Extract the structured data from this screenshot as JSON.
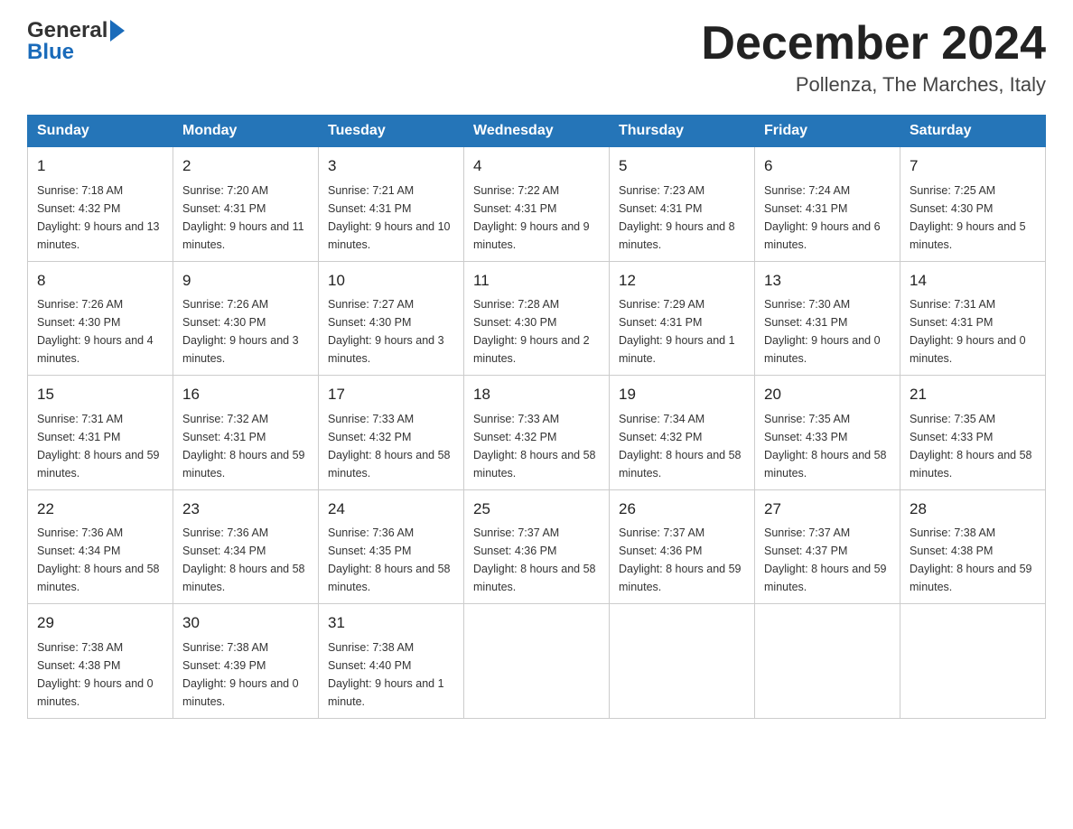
{
  "header": {
    "logo_general": "General",
    "logo_blue": "Blue",
    "month_title": "December 2024",
    "location": "Pollenza, The Marches, Italy"
  },
  "days_of_week": [
    "Sunday",
    "Monday",
    "Tuesday",
    "Wednesday",
    "Thursday",
    "Friday",
    "Saturday"
  ],
  "weeks": [
    [
      {
        "day": "1",
        "sunrise": "Sunrise: 7:18 AM",
        "sunset": "Sunset: 4:32 PM",
        "daylight": "Daylight: 9 hours and 13 minutes."
      },
      {
        "day": "2",
        "sunrise": "Sunrise: 7:20 AM",
        "sunset": "Sunset: 4:31 PM",
        "daylight": "Daylight: 9 hours and 11 minutes."
      },
      {
        "day": "3",
        "sunrise": "Sunrise: 7:21 AM",
        "sunset": "Sunset: 4:31 PM",
        "daylight": "Daylight: 9 hours and 10 minutes."
      },
      {
        "day": "4",
        "sunrise": "Sunrise: 7:22 AM",
        "sunset": "Sunset: 4:31 PM",
        "daylight": "Daylight: 9 hours and 9 minutes."
      },
      {
        "day": "5",
        "sunrise": "Sunrise: 7:23 AM",
        "sunset": "Sunset: 4:31 PM",
        "daylight": "Daylight: 9 hours and 8 minutes."
      },
      {
        "day": "6",
        "sunrise": "Sunrise: 7:24 AM",
        "sunset": "Sunset: 4:31 PM",
        "daylight": "Daylight: 9 hours and 6 minutes."
      },
      {
        "day": "7",
        "sunrise": "Sunrise: 7:25 AM",
        "sunset": "Sunset: 4:30 PM",
        "daylight": "Daylight: 9 hours and 5 minutes."
      }
    ],
    [
      {
        "day": "8",
        "sunrise": "Sunrise: 7:26 AM",
        "sunset": "Sunset: 4:30 PM",
        "daylight": "Daylight: 9 hours and 4 minutes."
      },
      {
        "day": "9",
        "sunrise": "Sunrise: 7:26 AM",
        "sunset": "Sunset: 4:30 PM",
        "daylight": "Daylight: 9 hours and 3 minutes."
      },
      {
        "day": "10",
        "sunrise": "Sunrise: 7:27 AM",
        "sunset": "Sunset: 4:30 PM",
        "daylight": "Daylight: 9 hours and 3 minutes."
      },
      {
        "day": "11",
        "sunrise": "Sunrise: 7:28 AM",
        "sunset": "Sunset: 4:30 PM",
        "daylight": "Daylight: 9 hours and 2 minutes."
      },
      {
        "day": "12",
        "sunrise": "Sunrise: 7:29 AM",
        "sunset": "Sunset: 4:31 PM",
        "daylight": "Daylight: 9 hours and 1 minute."
      },
      {
        "day": "13",
        "sunrise": "Sunrise: 7:30 AM",
        "sunset": "Sunset: 4:31 PM",
        "daylight": "Daylight: 9 hours and 0 minutes."
      },
      {
        "day": "14",
        "sunrise": "Sunrise: 7:31 AM",
        "sunset": "Sunset: 4:31 PM",
        "daylight": "Daylight: 9 hours and 0 minutes."
      }
    ],
    [
      {
        "day": "15",
        "sunrise": "Sunrise: 7:31 AM",
        "sunset": "Sunset: 4:31 PM",
        "daylight": "Daylight: 8 hours and 59 minutes."
      },
      {
        "day": "16",
        "sunrise": "Sunrise: 7:32 AM",
        "sunset": "Sunset: 4:31 PM",
        "daylight": "Daylight: 8 hours and 59 minutes."
      },
      {
        "day": "17",
        "sunrise": "Sunrise: 7:33 AM",
        "sunset": "Sunset: 4:32 PM",
        "daylight": "Daylight: 8 hours and 58 minutes."
      },
      {
        "day": "18",
        "sunrise": "Sunrise: 7:33 AM",
        "sunset": "Sunset: 4:32 PM",
        "daylight": "Daylight: 8 hours and 58 minutes."
      },
      {
        "day": "19",
        "sunrise": "Sunrise: 7:34 AM",
        "sunset": "Sunset: 4:32 PM",
        "daylight": "Daylight: 8 hours and 58 minutes."
      },
      {
        "day": "20",
        "sunrise": "Sunrise: 7:35 AM",
        "sunset": "Sunset: 4:33 PM",
        "daylight": "Daylight: 8 hours and 58 minutes."
      },
      {
        "day": "21",
        "sunrise": "Sunrise: 7:35 AM",
        "sunset": "Sunset: 4:33 PM",
        "daylight": "Daylight: 8 hours and 58 minutes."
      }
    ],
    [
      {
        "day": "22",
        "sunrise": "Sunrise: 7:36 AM",
        "sunset": "Sunset: 4:34 PM",
        "daylight": "Daylight: 8 hours and 58 minutes."
      },
      {
        "day": "23",
        "sunrise": "Sunrise: 7:36 AM",
        "sunset": "Sunset: 4:34 PM",
        "daylight": "Daylight: 8 hours and 58 minutes."
      },
      {
        "day": "24",
        "sunrise": "Sunrise: 7:36 AM",
        "sunset": "Sunset: 4:35 PM",
        "daylight": "Daylight: 8 hours and 58 minutes."
      },
      {
        "day": "25",
        "sunrise": "Sunrise: 7:37 AM",
        "sunset": "Sunset: 4:36 PM",
        "daylight": "Daylight: 8 hours and 58 minutes."
      },
      {
        "day": "26",
        "sunrise": "Sunrise: 7:37 AM",
        "sunset": "Sunset: 4:36 PM",
        "daylight": "Daylight: 8 hours and 59 minutes."
      },
      {
        "day": "27",
        "sunrise": "Sunrise: 7:37 AM",
        "sunset": "Sunset: 4:37 PM",
        "daylight": "Daylight: 8 hours and 59 minutes."
      },
      {
        "day": "28",
        "sunrise": "Sunrise: 7:38 AM",
        "sunset": "Sunset: 4:38 PM",
        "daylight": "Daylight: 8 hours and 59 minutes."
      }
    ],
    [
      {
        "day": "29",
        "sunrise": "Sunrise: 7:38 AM",
        "sunset": "Sunset: 4:38 PM",
        "daylight": "Daylight: 9 hours and 0 minutes."
      },
      {
        "day": "30",
        "sunrise": "Sunrise: 7:38 AM",
        "sunset": "Sunset: 4:39 PM",
        "daylight": "Daylight: 9 hours and 0 minutes."
      },
      {
        "day": "31",
        "sunrise": "Sunrise: 7:38 AM",
        "sunset": "Sunset: 4:40 PM",
        "daylight": "Daylight: 9 hours and 1 minute."
      },
      null,
      null,
      null,
      null
    ]
  ]
}
